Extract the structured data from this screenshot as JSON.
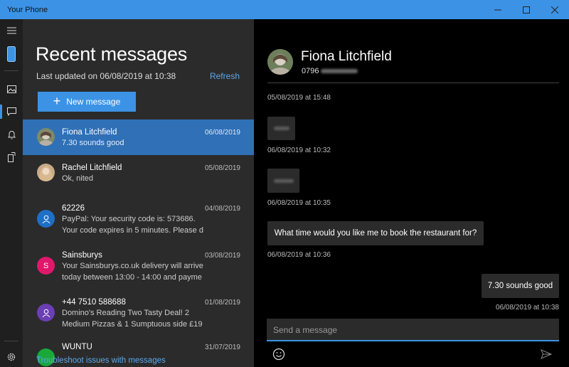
{
  "window": {
    "title": "Your Phone",
    "controls": [
      "minimize",
      "maximize",
      "close"
    ]
  },
  "rail": {
    "items": [
      {
        "icon": "hamburger-menu-icon"
      },
      {
        "icon": "phone-icon"
      },
      {
        "icon": "photos-icon"
      },
      {
        "icon": "messages-icon",
        "selected": true
      },
      {
        "icon": "notifications-icon"
      },
      {
        "icon": "apps-icon"
      },
      {
        "icon": "settings-icon"
      }
    ]
  },
  "list": {
    "title": "Recent messages",
    "last_updated": "Last updated on 06/08/2019 at 10:38",
    "refresh_label": "Refresh",
    "new_message_label": "New message",
    "troubleshoot_label": "Troubleshoot issues with messages",
    "conversations": [
      {
        "name": "Fiona Litchfield",
        "date": "06/08/2019",
        "line1": "7.30 sounds good",
        "line2": "",
        "avatar": "photo",
        "active": true
      },
      {
        "name": "Rachel Litchfield",
        "date": "05/08/2019",
        "line1": "Ok, nited",
        "line2": "",
        "avatar": "photo"
      },
      {
        "name": "62226",
        "date": "04/08/2019",
        "line1": "PayPal: Your security code is: 573686.",
        "line2": "Your code expires in 5 minutes. Please d",
        "avatar": "person",
        "color": "#1f6fc4"
      },
      {
        "name": "Sainsburys",
        "date": "03/08/2019",
        "line1": "Your Sainsburys.co.uk delivery will arrive",
        "line2": "today between 13:00 - 14:00 and payme",
        "avatar": "letter",
        "letter": "S",
        "color": "#e0186b"
      },
      {
        "name": "+44 7510 588688",
        "date": "01/08/2019",
        "line1": "Domino's Reading Two Tasty Deal! 2",
        "line2": "Medium Pizzas & 1 Sumptuous side £19",
        "avatar": "person",
        "color": "#6b3fb5"
      },
      {
        "name": "WUNTU",
        "date": "31/07/2019",
        "line1": "",
        "line2": "",
        "avatar": "blank",
        "color": "#1aa83a"
      }
    ]
  },
  "chat": {
    "contact_name": "Fiona Litchfield",
    "contact_number": "0796",
    "messages": [
      {
        "type": "timestamp",
        "text": "05/08/2019 at 15:48"
      },
      {
        "type": "incoming-redacted"
      },
      {
        "type": "timestamp",
        "text": "06/08/2019 at 10:32"
      },
      {
        "type": "incoming-redacted"
      },
      {
        "type": "timestamp",
        "text": "06/08/2019 at 10:35"
      },
      {
        "type": "incoming",
        "text": "What time would you like me to book the restaurant for?"
      },
      {
        "type": "timestamp",
        "text": "06/08/2019 at 10:36"
      },
      {
        "type": "outgoing",
        "text": "7.30 sounds good"
      },
      {
        "type": "timestamp",
        "text": "06/08/2019 at 10:38"
      }
    ],
    "composer_placeholder": "Send a message"
  },
  "colors": {
    "accent": "#3c93e6",
    "active_row": "#2f70b6",
    "list_bg": "#2b2b2b",
    "rail_bg": "#1f1f1f",
    "chat_bg": "#000000",
    "link": "#5aa9ef"
  }
}
